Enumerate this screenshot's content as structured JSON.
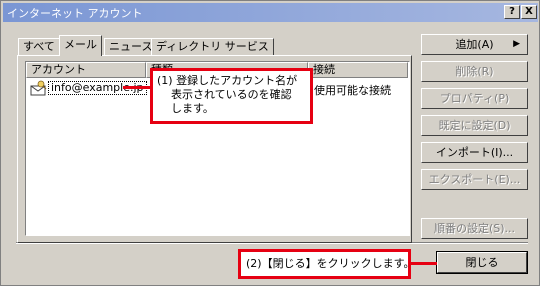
{
  "window": {
    "title": "インターネット アカウント",
    "help_btn": "?",
    "close_btn": "X"
  },
  "tabs": [
    {
      "label": "すべて",
      "active": false
    },
    {
      "label": "メール",
      "active": true
    },
    {
      "label": "ニュース",
      "active": false
    },
    {
      "label": "ディレクトリ サービス",
      "active": false
    }
  ],
  "list": {
    "columns": [
      "アカウント",
      "種類",
      "接続"
    ],
    "rows": [
      {
        "account": "info@example.jp",
        "connection": "使用可能な接続"
      }
    ]
  },
  "buttons": {
    "add": "追加(A)",
    "remove": "削除(R)",
    "properties": "プロパティ(P)",
    "set_default": "既定に設定(D)",
    "import": "インポート(I)...",
    "export": "エクスポート(E)...",
    "set_order": "順番の設定(S)...",
    "close": "閉じる"
  },
  "callouts": {
    "step1_line1": "(1) 登録したアカウント名が",
    "step1_line2": "表示されているのを確認",
    "step1_line3": "します。",
    "step2": "(2)【閉じる】をクリックします。"
  },
  "colors": {
    "callout_border": "#e60012",
    "titlebar_start": "#7a96d4",
    "titlebar_end": "#a6b7e0",
    "face": "#d4d0c8"
  }
}
